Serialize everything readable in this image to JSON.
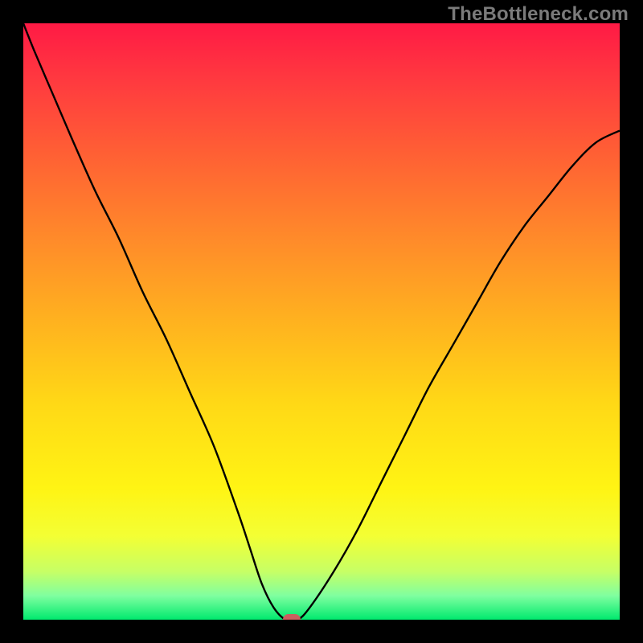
{
  "watermark": "TheBottleneck.com",
  "chart_data": {
    "type": "line",
    "title": "",
    "xlabel": "",
    "ylabel": "",
    "xlim": [
      0,
      100
    ],
    "ylim": [
      0,
      100
    ],
    "grid": false,
    "legend": false,
    "series": [
      {
        "name": "bottleneck-curve",
        "x": [
          0,
          2,
          5,
          8,
          12,
          16,
          20,
          24,
          28,
          32,
          36,
          38,
          40,
          42,
          44,
          46,
          48,
          52,
          56,
          60,
          64,
          68,
          72,
          76,
          80,
          84,
          88,
          92,
          96,
          100
        ],
        "y": [
          100,
          95,
          88,
          81,
          72,
          64,
          55,
          47,
          38,
          29,
          18,
          12,
          6,
          2,
          0,
          0,
          2,
          8,
          15,
          23,
          31,
          39,
          46,
          53,
          60,
          66,
          71,
          76,
          80,
          82
        ],
        "stroke": "#000000"
      }
    ],
    "marker": {
      "x": 45,
      "y": 0,
      "color": "#cc5f5f",
      "shape": "rounded-rect"
    },
    "gradient_stops": [
      {
        "pos": 0.0,
        "color": "#ff1a45"
      },
      {
        "pos": 0.1,
        "color": "#ff3b3f"
      },
      {
        "pos": 0.22,
        "color": "#ff6034"
      },
      {
        "pos": 0.36,
        "color": "#ff8a2a"
      },
      {
        "pos": 0.5,
        "color": "#ffb21f"
      },
      {
        "pos": 0.64,
        "color": "#ffd916"
      },
      {
        "pos": 0.78,
        "color": "#fff414"
      },
      {
        "pos": 0.86,
        "color": "#f3ff34"
      },
      {
        "pos": 0.92,
        "color": "#c6ff66"
      },
      {
        "pos": 0.96,
        "color": "#7fffa0"
      },
      {
        "pos": 1.0,
        "color": "#00e96e"
      }
    ]
  }
}
